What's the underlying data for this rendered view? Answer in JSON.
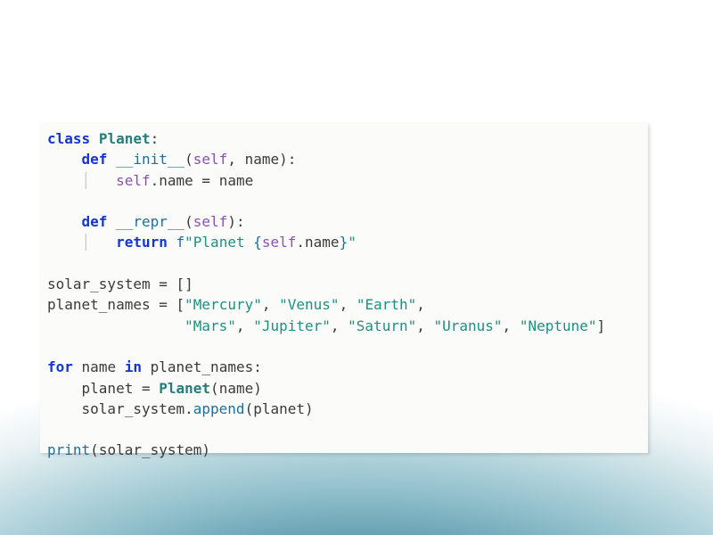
{
  "code": {
    "kw_class": "class",
    "class_name": "Planet",
    "kw_def1": "def",
    "fn_init": "__init__",
    "self1": "self",
    "param_name1": "name",
    "self2": "self",
    "attr_name1": "name",
    "eq1": "=",
    "rhs_name1": "name",
    "kw_def2": "def",
    "fn_repr": "__repr__",
    "self3": "self",
    "kw_return": "return",
    "fprefix": "f",
    "str_open": "\"Planet ",
    "brace_open": "{",
    "self4": "self",
    "dot2": ".",
    "attr_name2": "name",
    "brace_close": "}",
    "str_close": "\"",
    "var_solar": "solar_system",
    "eq2": "=",
    "empty_list": "[]",
    "var_planet_names": "planet_names",
    "eq3": "=",
    "lbrack": "[",
    "s_mercury": "\"Mercury\"",
    "s_venus": "\"Venus\"",
    "s_earth": "\"Earth\"",
    "s_mars": "\"Mars\"",
    "s_jupiter": "\"Jupiter\"",
    "s_saturn": "\"Saturn\"",
    "s_uranus": "\"Uranus\"",
    "s_neptune": "\"Neptune\"",
    "rbrack": "]",
    "kw_for": "for",
    "loop_var": "name",
    "kw_in": "in",
    "iter_var": "planet_names",
    "body_var1": "planet",
    "eq4": "=",
    "ctor_call": "Planet",
    "ctor_arg": "name",
    "body_var2": "solar_system",
    "method_append": "append",
    "append_arg": "planet",
    "fn_print": "print",
    "print_arg": "solar_system"
  }
}
